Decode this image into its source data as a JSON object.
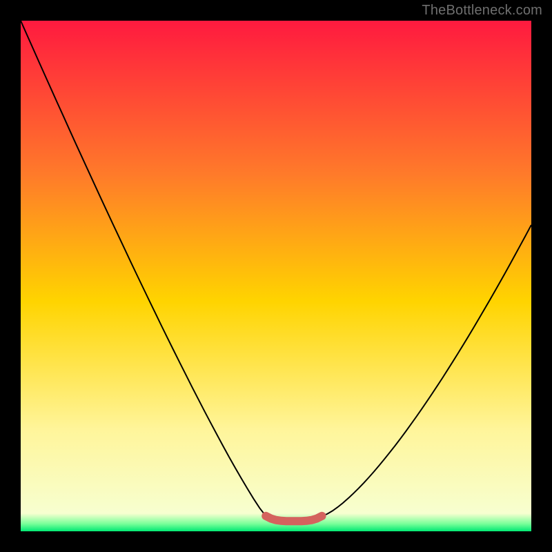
{
  "watermark": "TheBottleneck.com",
  "colors": {
    "frame": "#000000",
    "grad_top": "#ff1a3f",
    "grad_mid_upper": "#ff7a2a",
    "grad_mid": "#ffd400",
    "grad_lower": "#fff59a",
    "grad_bottom": "#00e873",
    "curve": "#000000",
    "marker": "#d4635e",
    "watermark_text": "#6f6f6f"
  },
  "chart_data": {
    "type": "line",
    "title": "",
    "xlabel": "",
    "ylabel": "",
    "xlim": [
      0,
      100
    ],
    "ylim": [
      0,
      100
    ],
    "legend": false,
    "grid": false,
    "annotations": [],
    "series": [
      {
        "name": "left-branch-curve",
        "x": [
          0,
          48
        ],
        "values": [
          100,
          3
        ],
        "style": "line"
      },
      {
        "name": "right-branch-curve",
        "x": [
          59,
          100
        ],
        "values": [
          3,
          60
        ],
        "style": "line"
      },
      {
        "name": "flat-bottom-marker",
        "x": [
          48,
          49,
          50,
          51,
          52,
          53,
          54,
          55,
          56,
          57,
          58,
          59
        ],
        "values": [
          3,
          2.5,
          2.2,
          2.05,
          2,
          2,
          2,
          2,
          2.05,
          2.2,
          2.5,
          3
        ],
        "style": "marker"
      }
    ],
    "background_gradient": {
      "direction": "vertical",
      "stops": [
        {
          "pos": 0.0,
          "color": "#ff1a3f"
        },
        {
          "pos": 0.3,
          "color": "#ff7a2a"
        },
        {
          "pos": 0.55,
          "color": "#ffd400"
        },
        {
          "pos": 0.8,
          "color": "#fff59a"
        },
        {
          "pos": 0.965,
          "color": "#f7ffd0"
        },
        {
          "pos": 0.985,
          "color": "#7bff9a"
        },
        {
          "pos": 1.0,
          "color": "#00e873"
        }
      ]
    }
  }
}
